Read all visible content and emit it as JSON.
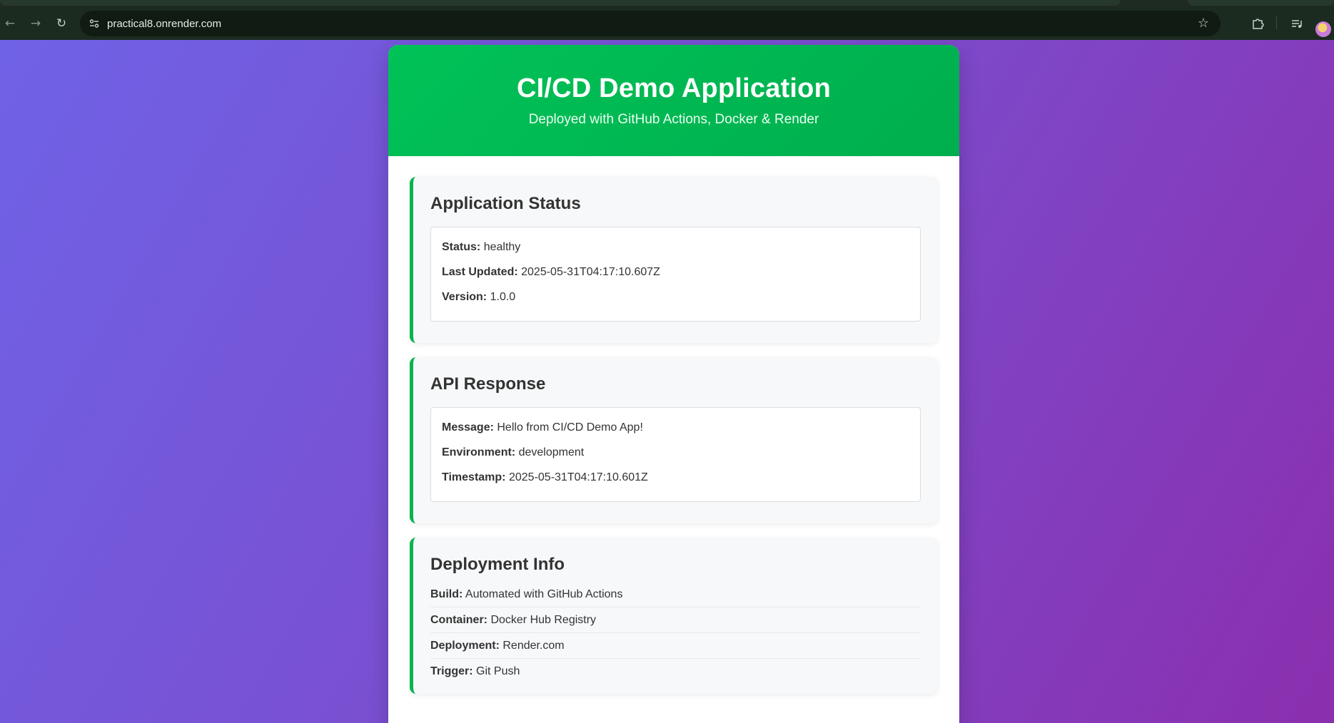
{
  "browser": {
    "url": "practical8.onrender.com",
    "icons": {
      "back": "arrow-left-icon",
      "forward": "arrow-right-icon",
      "reload": "reload-icon",
      "site_info": "site-settings-icon",
      "bookmark": "star-icon",
      "extensions": "puzzle-icon",
      "media": "media-control-icon",
      "profile": "profile-avatar"
    }
  },
  "header": {
    "title": "CI/CD Demo Application",
    "subtitle": "Deployed with GitHub Actions, Docker & Render"
  },
  "status_card": {
    "title": "Application Status",
    "rows": [
      {
        "label": "Status:",
        "value": "healthy"
      },
      {
        "label": "Last Updated:",
        "value": "2025-05-31T04:17:10.607Z"
      },
      {
        "label": "Version:",
        "value": "1.0.0"
      }
    ]
  },
  "api_card": {
    "title": "API Response",
    "rows": [
      {
        "label": "Message:",
        "value": "Hello from CI/CD Demo App!"
      },
      {
        "label": "Environment:",
        "value": "development"
      },
      {
        "label": "Timestamp:",
        "value": "2025-05-31T04:17:10.601Z"
      }
    ]
  },
  "deploy_card": {
    "title": "Deployment Info",
    "rows": [
      {
        "label": "Build:",
        "value": "Automated with GitHub Actions"
      },
      {
        "label": "Container:",
        "value": "Docker Hub Registry"
      },
      {
        "label": "Deployment:",
        "value": "Render.com"
      },
      {
        "label": "Trigger:",
        "value": "Git Push"
      }
    ]
  },
  "colors": {
    "header_green": "#00b954",
    "accent_border": "#0ab44f",
    "background_start": "#6f62e6",
    "background_end": "#8a2fae"
  }
}
